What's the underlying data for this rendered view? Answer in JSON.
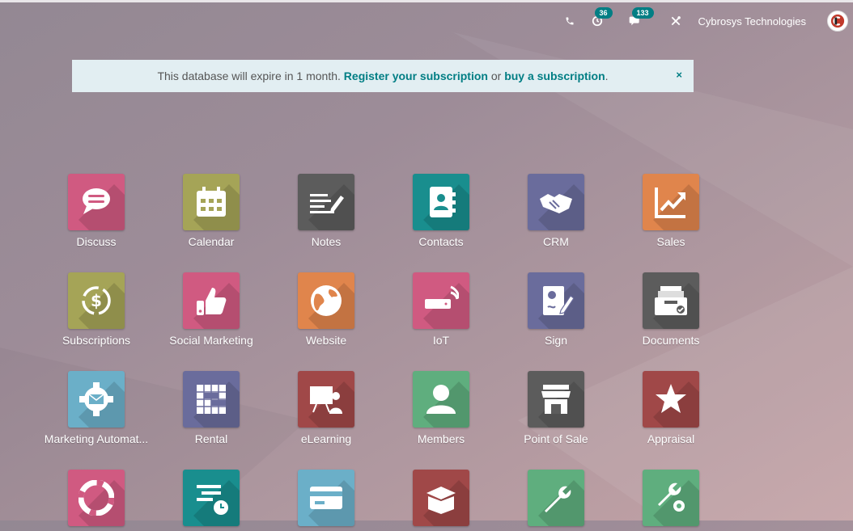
{
  "systray": {
    "activity_badge": "36",
    "messages_badge": "133",
    "company": "Cybrosys Technologies"
  },
  "alert": {
    "text_before": "This database will expire in 1 month.",
    "register_link": "Register your subscription",
    "text_middle": "or",
    "buy_link": "buy a subscription",
    "text_after": ".",
    "close_label": "×"
  },
  "apps": [
    {
      "label": "Discuss",
      "icon": "chat-bubble-icon",
      "color": "#d05a81"
    },
    {
      "label": "Calendar",
      "icon": "calendar-icon",
      "color": "#a5a457"
    },
    {
      "label": "Notes",
      "icon": "notes-icon",
      "color": "#5c5c5c"
    },
    {
      "label": "Contacts",
      "icon": "contacts-book-icon",
      "color": "#198e8e"
    },
    {
      "label": "CRM",
      "icon": "handshake-icon",
      "color": "#6a6c9c"
    },
    {
      "label": "Sales",
      "icon": "trend-chart-icon",
      "color": "#e0854c"
    },
    {
      "label": "Subscriptions",
      "icon": "recurring-dollar-icon",
      "color": "#a5a457"
    },
    {
      "label": "Social Marketing",
      "icon": "thumbs-up-icon",
      "color": "#d05a81"
    },
    {
      "label": "Website",
      "icon": "globe-icon",
      "color": "#e0854c"
    },
    {
      "label": "IoT",
      "icon": "iot-device-icon",
      "color": "#d05a81"
    },
    {
      "label": "Sign",
      "icon": "sign-document-icon",
      "color": "#6a6c9c"
    },
    {
      "label": "Documents",
      "icon": "documents-tray-icon",
      "color": "#5c5c5c"
    },
    {
      "label": "Marketing Automat...",
      "icon": "gear-mail-icon",
      "color": "#6bafc8"
    },
    {
      "label": "Rental",
      "icon": "rental-grid-icon",
      "color": "#6a6c9c"
    },
    {
      "label": "eLearning",
      "icon": "presentation-icon",
      "color": "#a04848"
    },
    {
      "label": "Members",
      "icon": "member-icon",
      "color": "#5fae7e"
    },
    {
      "label": "Point of Sale",
      "icon": "shop-icon",
      "color": "#5c5c5c"
    },
    {
      "label": "Appraisal",
      "icon": "star-icon",
      "color": "#a04848"
    },
    {
      "label": "",
      "icon": "lifebuoy-icon",
      "color": "#d05a81"
    },
    {
      "label": "",
      "icon": "planning-icon",
      "color": "#198e8e"
    },
    {
      "label": "",
      "icon": "payment-card-icon",
      "color": "#6bafc8"
    },
    {
      "label": "",
      "icon": "open-box-icon",
      "color": "#a04848"
    },
    {
      "label": "",
      "icon": "wrench-icon",
      "color": "#5fae7e"
    },
    {
      "label": "",
      "icon": "wrench-gear-icon",
      "color": "#5fae7e"
    }
  ]
}
